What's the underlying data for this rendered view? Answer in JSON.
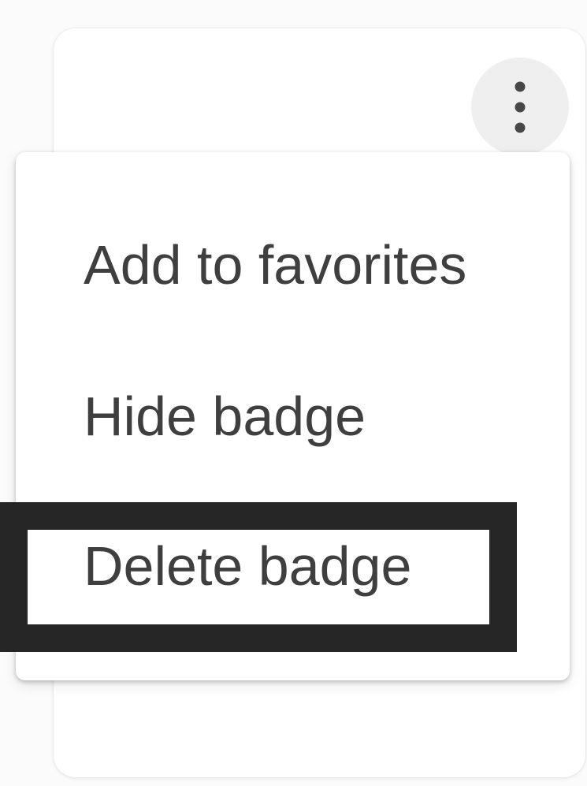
{
  "menu": {
    "items": [
      {
        "label": "Add to favorites"
      },
      {
        "label": "Hide badge"
      },
      {
        "label": "Delete badge",
        "highlighted": true
      }
    ]
  },
  "icons": {
    "more_button": "more-vert-icon"
  },
  "colors": {
    "page_background": "#fbfbfb",
    "card_background": "#ffffff",
    "menu_text": "#3f3f3f",
    "icon_button_background": "#efefef",
    "icon_dots": "#474747",
    "highlight_frame": "#262626"
  }
}
